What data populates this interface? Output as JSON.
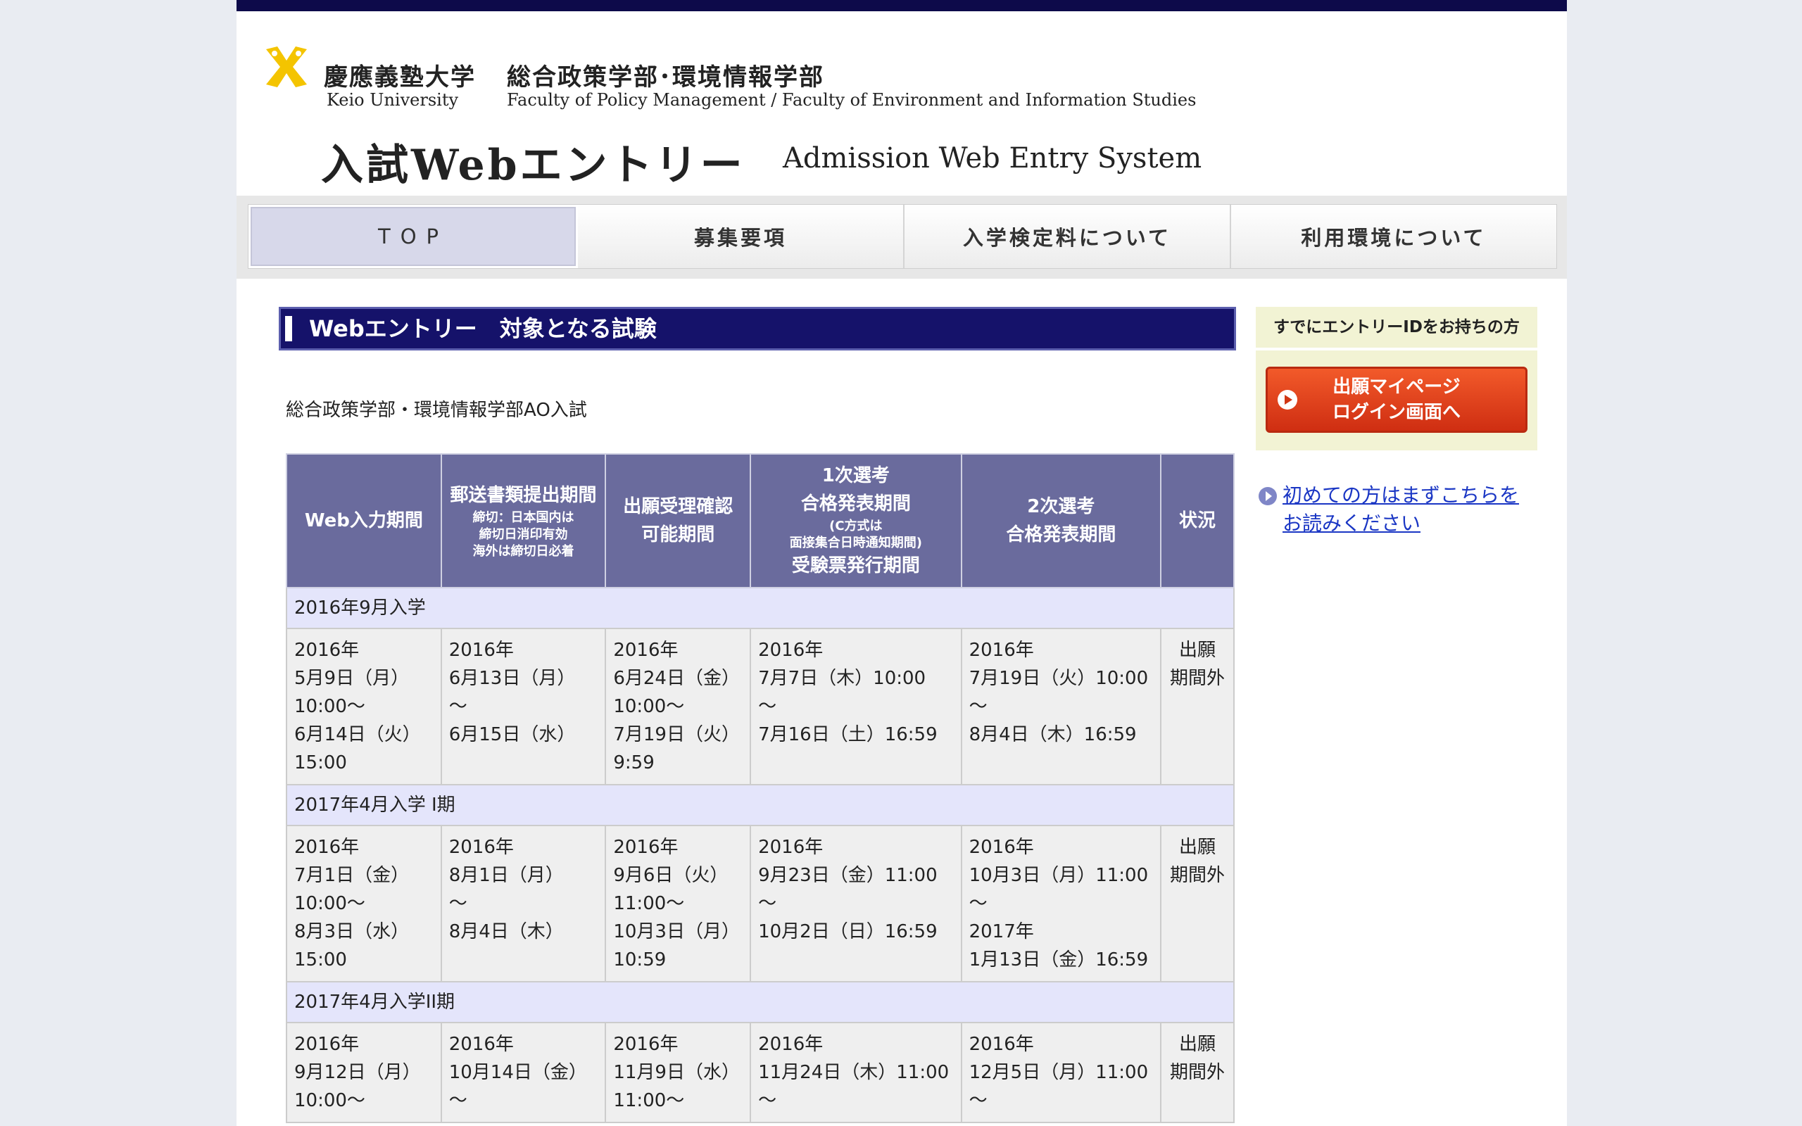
{
  "header": {
    "univ_jp": "慶應義塾大学",
    "univ_en": "Keio University",
    "faculty_jp": "総合政策学部･環境情報学部",
    "faculty_en": "Faculty of Policy Management / Faculty of Environment and Information Studies",
    "system_jp": "入試Webエントリー",
    "system_en": "Admission Web Entry System"
  },
  "nav": {
    "items": [
      {
        "label": "TOP"
      },
      {
        "label": "募集要項"
      },
      {
        "label": "入学検定料について"
      },
      {
        "label": "利用環境について"
      }
    ]
  },
  "main": {
    "section_title": "Webエントリー　対象となる試験",
    "subtitle": "総合政策学部・環境情報学部AO入試",
    "table": {
      "headers": {
        "web": "Web入力期間",
        "mail_main": "郵送書類提出期間",
        "mail_note1": "締切：日本国内は",
        "mail_note2": "締切日消印有効",
        "mail_note3": "海外は締切日必着",
        "confirm1": "出願受理確認",
        "confirm2": "可能期間",
        "first1": "1次選考",
        "first2": "合格発表期間",
        "first_note1": "(C方式は",
        "first_note2": "面接集合日時通知期間)",
        "first3": "受験票発行期間",
        "second1": "2次選考",
        "second2": "合格発表期間",
        "status": "状況"
      },
      "groups": [
        {
          "term": "2016年9月入学",
          "cells": [
            [
              "2016年",
              "5月9日（月）",
              "10:00～",
              "6月14日（火）",
              "15:00"
            ],
            [
              "2016年",
              "6月13日（月）",
              "～",
              "6月15日（水）"
            ],
            [
              "2016年",
              "6月24日（金）",
              "10:00～",
              "7月19日（火）",
              "9:59"
            ],
            [
              "2016年",
              "7月7日（木）10:00",
              "～",
              "7月16日（土）16:59"
            ],
            [
              "2016年",
              "7月19日（火）10:00",
              "～",
              "8月4日（木）16:59"
            ],
            [
              "出願",
              "期間外"
            ]
          ]
        },
        {
          "term": "2017年4月入学 I期",
          "cells": [
            [
              "2016年",
              "7月1日（金）",
              "10:00～",
              "8月3日（水）",
              "15:00"
            ],
            [
              "2016年",
              "8月1日（月）",
              "～",
              "8月4日（木）"
            ],
            [
              "2016年",
              "9月6日（火）",
              "11:00～",
              "10月3日（月）",
              "10:59"
            ],
            [
              "2016年",
              "9月23日（金）11:00",
              "～",
              "10月2日（日）16:59"
            ],
            [
              "2016年",
              "10月3日（月）11:00",
              "～",
              "2017年",
              "1月13日（金）16:59"
            ],
            [
              "出願",
              "期間外"
            ]
          ]
        },
        {
          "term": "2017年4月入学II期",
          "cells": [
            [
              "2016年",
              "9月12日（月）",
              "10:00～"
            ],
            [
              "2016年",
              "10月14日（金）",
              "～"
            ],
            [
              "2016年",
              "11月9日（水）",
              "11:00～"
            ],
            [
              "2016年",
              "11月24日（木）11:00",
              "～"
            ],
            [
              "2016年",
              "12月5日（月）11:00",
              "～"
            ],
            [
              "出願",
              "期間外"
            ]
          ]
        }
      ]
    }
  },
  "side": {
    "title": "すでにエントリーIDをお持ちの方",
    "login_line1": "出願マイページ",
    "login_line2": "ログイン画面へ",
    "link_line1": "初めての方はまずこちらを",
    "link_line2": "お読みください"
  },
  "colors": {
    "topbar": "#0d0a4a",
    "section_header": "#15126a",
    "table_header": "#6a6b9d",
    "term_row": "#e4e5fb",
    "login_button": "#e04420",
    "link": "#1a36c4",
    "logo": "#f4c400"
  }
}
